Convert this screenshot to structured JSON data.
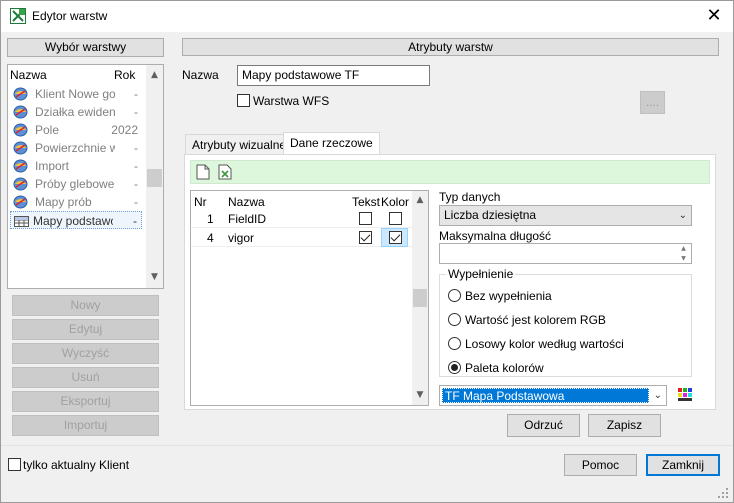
{
  "window": {
    "title": "Edytor warstw"
  },
  "left": {
    "header": "Wybór warstwy",
    "columns": {
      "name": "Nazwa",
      "year": "Rok"
    },
    "layers": [
      {
        "name": "Klient Nowe gosp",
        "year": "-"
      },
      {
        "name": "Działka ewidenc",
        "year": "-"
      },
      {
        "name": "Pole",
        "year": "2022"
      },
      {
        "name": "Powierzchnie wy",
        "year": "-"
      },
      {
        "name": "Import",
        "year": "-"
      },
      {
        "name": "Próby glebowe",
        "year": "-"
      },
      {
        "name": "Mapy prób",
        "year": "-"
      },
      {
        "name": "Mapy podstawov",
        "year": "-"
      }
    ],
    "buttons": {
      "new": "Nowy",
      "edit": "Edytuj",
      "clear": "Wyczyść",
      "delete": "Usuń",
      "export": "Eksportuj",
      "import": "Importuj"
    }
  },
  "right": {
    "header": "Atrybuty warstw",
    "name_label": "Nazwa",
    "name_value": "Mapy podstawowe TF",
    "wfs_label": "Warstwa WFS",
    "more_button": "....",
    "tabs": {
      "visual": "Atrybuty wizualne",
      "data": "Dane rzeczowe"
    },
    "grid": {
      "columns": {
        "nr": "Nr",
        "name": "Nazwa",
        "text": "Tekst",
        "color": "Kolor"
      },
      "rows": [
        {
          "nr": "1",
          "name": "FieldID"
        },
        {
          "nr": "4",
          "name": "vigor"
        }
      ]
    },
    "data_type_label": "Typ danych",
    "data_type_value": "Liczba dziesiętna",
    "max_length_label": "Maksymalna długość",
    "fill": {
      "label": "Wypełnienie",
      "options": [
        "Bez wypełnienia",
        "Wartość jest kolorem RGB",
        "Losowy kolor według wartości",
        "Paleta kolorów"
      ]
    },
    "palette_value": "TF Mapa Podstawowa",
    "buttons": {
      "discard": "Odrzuć",
      "save": "Zapisz"
    }
  },
  "footer": {
    "only_current_client": "tylko aktualny Klient",
    "help": "Pomoc",
    "close": "Zamknij"
  },
  "colors": {
    "accent": "#0078d7",
    "toolbar_green": "#ddf7dd"
  }
}
